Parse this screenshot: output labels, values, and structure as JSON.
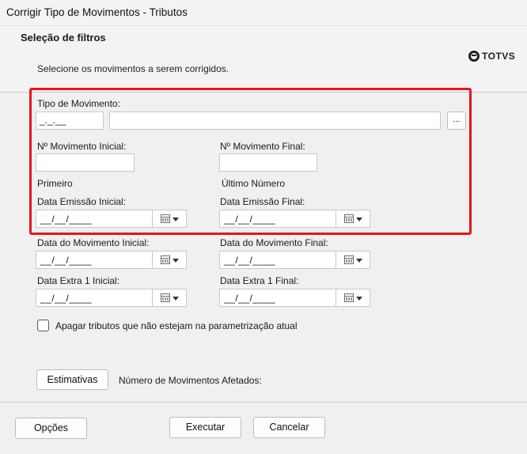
{
  "window": {
    "title": "Corrigir Tipo de Movimentos - Tributos"
  },
  "header": {
    "title": "Seleção de filtros",
    "subtitle": "Selecione os movimentos a serem corrigidos.",
    "logo_text": "TOTVS"
  },
  "form": {
    "tipo_movimento": {
      "label": "Tipo de Movimento:",
      "code_value": "_._.__",
      "desc_value": "",
      "browse_label": "..."
    },
    "mov_inicial": {
      "label": "Nº Movimento Inicial:",
      "value": "",
      "hint": "Primeiro"
    },
    "mov_final": {
      "label": "Nº Movimento Final:",
      "value": "",
      "hint": "Último Número"
    },
    "data_emissao_inicial": {
      "label": "Data Emissão Inicial:",
      "value": "__/__/____"
    },
    "data_emissao_final": {
      "label": "Data Emissão Final:",
      "value": "__/__/____"
    },
    "data_movimento_inicial": {
      "label": "Data do Movimento Inicial:",
      "value": "__/__/____"
    },
    "data_movimento_final": {
      "label": "Data do Movimento Final:",
      "value": "__/__/____"
    },
    "data_extra_inicial": {
      "label": "Data Extra 1 Inicial:",
      "value": "__/__/____"
    },
    "data_extra_final": {
      "label": "Data Extra 1 Final:",
      "value": "__/__/____"
    },
    "apagar_checkbox": {
      "label": "Apagar tributos que não estejam na parametrização atual",
      "checked": false
    },
    "estimativas_button": "Estimativas",
    "afetados_label": "Número de Movimentos Afetados:"
  },
  "footer": {
    "options_label": "Opções",
    "execute_label": "Executar",
    "cancel_label": "Cancelar"
  },
  "colors": {
    "highlight": "#e8141b",
    "background": "#f0f0f0"
  }
}
